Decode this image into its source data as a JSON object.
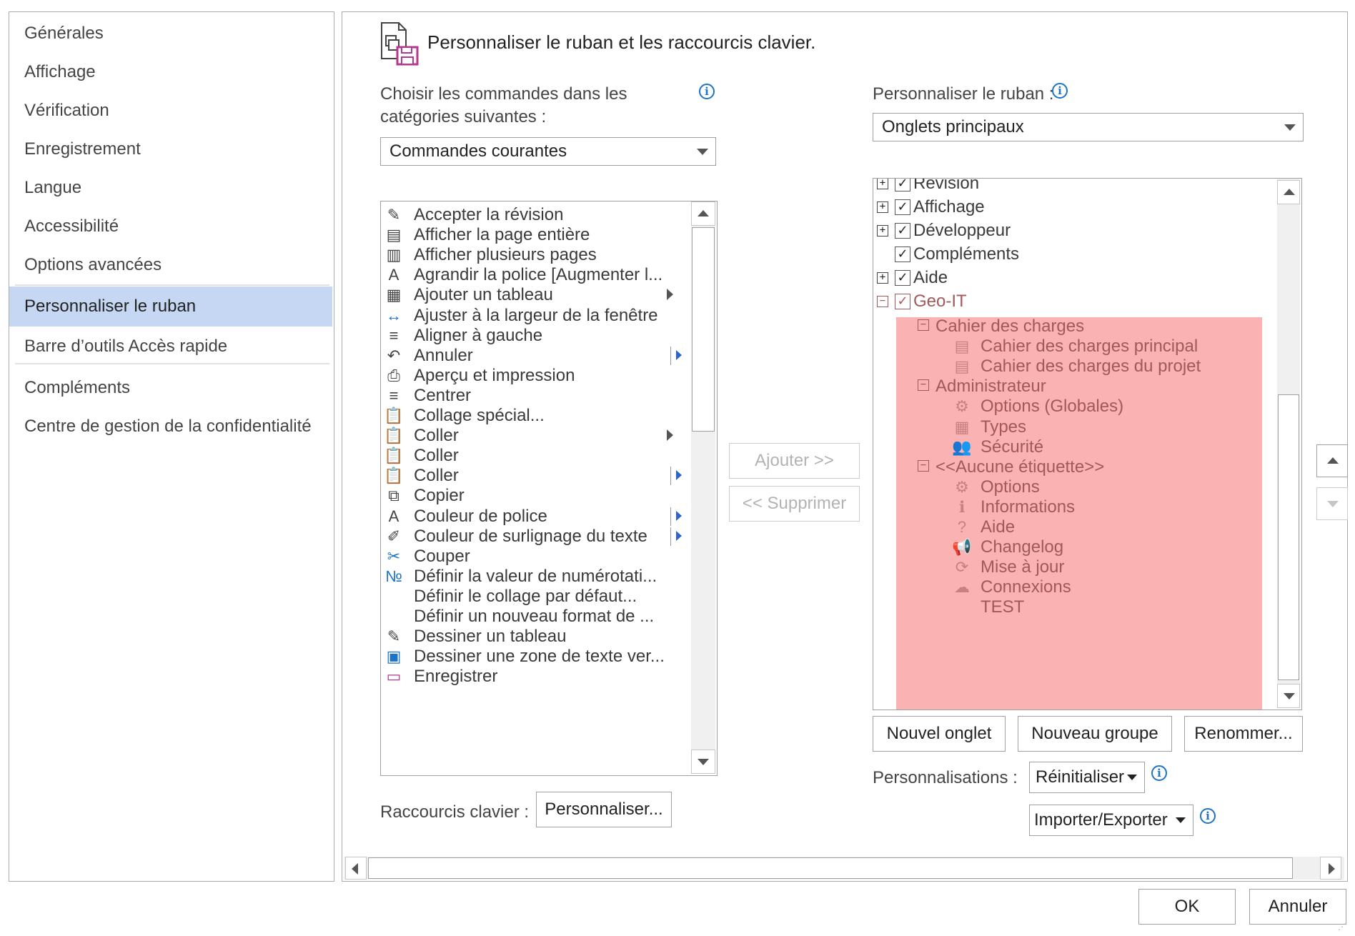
{
  "nav": {
    "items": [
      "Générales",
      "Affichage",
      "Vérification",
      "Enregistrement",
      "Langue",
      "Accessibilité",
      "Options avancées",
      "Personnaliser le ruban",
      "Barre d’outils Accès rapide",
      "Compléments",
      "Centre de gestion de la confidentialité"
    ],
    "selected": "Personnaliser le ruban"
  },
  "header": {
    "title": "Personnaliser le ruban et les raccourcis clavier."
  },
  "left": {
    "choose_label_line1": "Choisir les commandes dans les",
    "choose_label_line2": "catégories suivantes :",
    "category_value": "Commandes courantes",
    "commands": [
      {
        "label": "Accepter la révision",
        "icon": "accept-revision-icon"
      },
      {
        "label": "Afficher la page entière",
        "icon": "page-icon"
      },
      {
        "label": "Afficher plusieurs pages",
        "icon": "multi-page-icon"
      },
      {
        "label": "Agrandir la police [Augmenter l...",
        "icon": "grow-font-icon"
      },
      {
        "label": "Ajouter un tableau",
        "icon": "table-icon",
        "submenu": "plain"
      },
      {
        "label": "Ajuster à la largeur de la fenêtre",
        "icon": "fit-width-icon"
      },
      {
        "label": "Aligner à gauche",
        "icon": "align-left-icon"
      },
      {
        "label": "Annuler",
        "icon": "undo-icon",
        "submenu": "split"
      },
      {
        "label": "Aperçu et impression",
        "icon": "print-preview-icon"
      },
      {
        "label": "Centrer",
        "icon": "center-icon"
      },
      {
        "label": "Collage spécial...",
        "icon": "paste-special-icon"
      },
      {
        "label": "Coller",
        "icon": "paste-icon",
        "submenu": "plain"
      },
      {
        "label": "Coller",
        "icon": "paste-icon"
      },
      {
        "label": "Coller",
        "icon": "paste-icon",
        "submenu": "split"
      },
      {
        "label": "Copier",
        "icon": "copy-icon"
      },
      {
        "label": "Couleur de police",
        "icon": "font-color-icon",
        "submenu": "split"
      },
      {
        "label": "Couleur de surlignage du texte",
        "icon": "highlight-icon",
        "submenu": "split"
      },
      {
        "label": "Couper",
        "icon": "cut-icon"
      },
      {
        "label": "Définir la valeur de numérotati...",
        "icon": "numbering-icon"
      },
      {
        "label": "Définir le collage par défaut...",
        "icon": ""
      },
      {
        "label": "Définir un nouveau format de ...",
        "icon": ""
      },
      {
        "label": "Dessiner un tableau",
        "icon": "draw-table-icon"
      },
      {
        "label": "Dessiner une zone de texte ver...",
        "icon": "textbox-icon"
      },
      {
        "label": "Enregistrer",
        "icon": "save-icon"
      }
    ],
    "shortcuts_label": "Raccourcis clavier :",
    "customize_button": "Personnaliser..."
  },
  "middle": {
    "add_button": "Ajouter >>",
    "remove_button": "<< Supprimer"
  },
  "right": {
    "customize_label": "Personnaliser le ruban :",
    "tabs_value": "Onglets principaux",
    "tree": [
      {
        "label": "Révision",
        "level": 0,
        "expander": "+",
        "checked": true
      },
      {
        "label": "Affichage",
        "level": 0,
        "expander": "+",
        "checked": true
      },
      {
        "label": "Développeur",
        "level": 0,
        "expander": "+",
        "checked": true
      },
      {
        "label": "Compléments",
        "level": 0,
        "expander": "",
        "checked": true
      },
      {
        "label": "Aide",
        "level": 0,
        "expander": "+",
        "checked": true
      },
      {
        "label": "Geo-IT",
        "level": 0,
        "expander": "−",
        "checked": true,
        "highlight": true
      },
      {
        "label": "Cahier des charges",
        "level": 1,
        "expander": "−"
      },
      {
        "label": "Cahier des charges principal",
        "level": 2,
        "icon": "document-icon"
      },
      {
        "label": "Cahier des charges du projet",
        "level": 2,
        "icon": "document-icon"
      },
      {
        "label": "Administrateur",
        "level": 1,
        "expander": "−"
      },
      {
        "label": "Options (Globales)",
        "level": 2,
        "icon": "gear-icon"
      },
      {
        "label": "Types",
        "level": 2,
        "icon": "table-icon"
      },
      {
        "label": "Sécurité",
        "level": 2,
        "icon": "users-icon"
      },
      {
        "label": "<<Aucune étiquette>>",
        "level": 1,
        "expander": "−"
      },
      {
        "label": "Options",
        "level": 2,
        "icon": "gear-icon"
      },
      {
        "label": "Informations",
        "level": 2,
        "icon": "info-icon"
      },
      {
        "label": "Aide",
        "level": 2,
        "icon": "help-icon"
      },
      {
        "label": "Changelog",
        "level": 2,
        "icon": "megaphone-icon"
      },
      {
        "label": "Mise à jour",
        "level": 2,
        "icon": "refresh-icon"
      },
      {
        "label": "Connexions",
        "level": 2,
        "icon": "cloud-icon"
      },
      {
        "label": "TEST",
        "level": 2,
        "icon": ""
      }
    ],
    "new_tab_button": "Nouvel onglet",
    "new_group_button": "Nouveau groupe",
    "rename_button": "Renommer...",
    "customizations_label": "Personnalisations :",
    "reset_button": "Réinitialiser",
    "import_export_button": "Importer/Exporter"
  },
  "footer": {
    "ok_button": "OK",
    "cancel_button": "Annuler"
  },
  "colors": {
    "nav_selected": "#c5d7f2",
    "highlight": "#fbb2b3",
    "highlight_text": "#a3585a",
    "info_blue": "#1c73c7"
  }
}
